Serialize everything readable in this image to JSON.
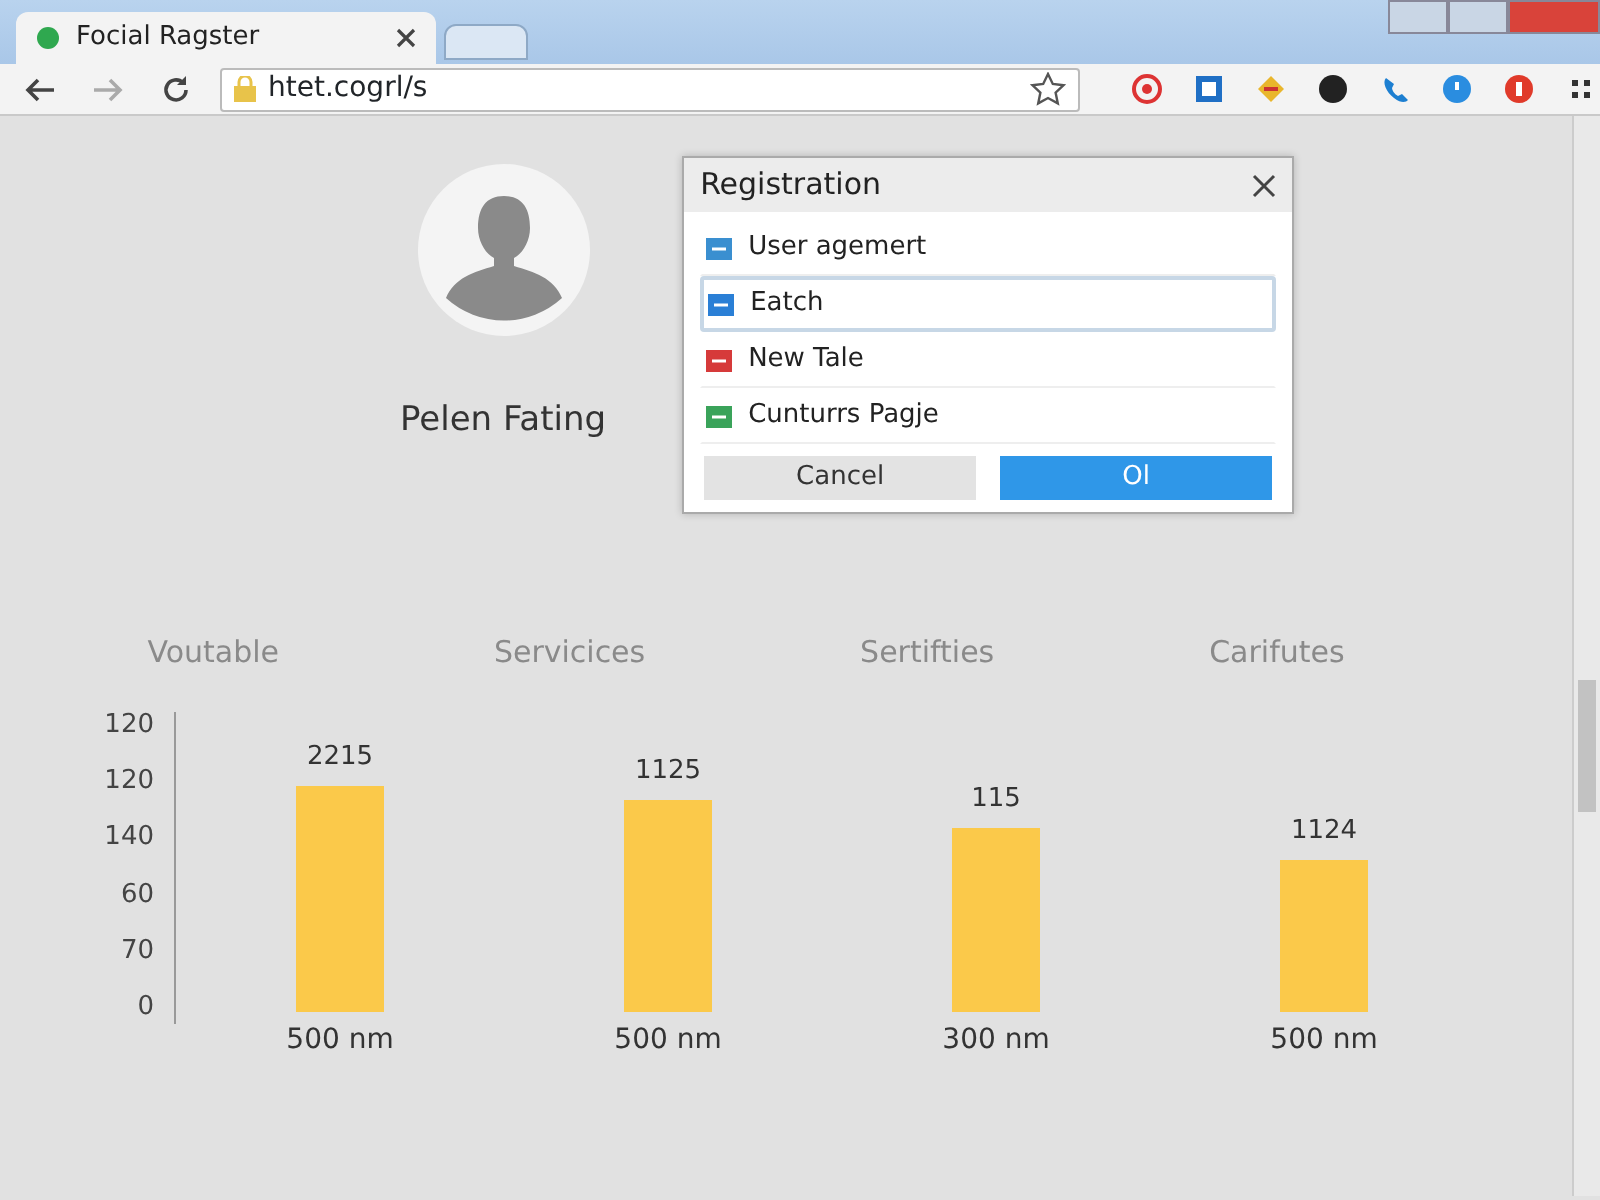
{
  "browser": {
    "tabs": [
      {
        "title": "Focial Ragster",
        "selected": true
      },
      {
        "selected": false
      }
    ],
    "address": "htet.cogrl/s"
  },
  "profile": {
    "name": "Pelen Fating"
  },
  "dialog": {
    "title": "Registration",
    "items": [
      {
        "label": "User agemert",
        "color": "#3a8fd0",
        "selected": false
      },
      {
        "label": "Eatch",
        "color": "#2a7fd6",
        "selected": true
      },
      {
        "label": "New Tale",
        "color": "#d63a3a",
        "selected": false
      },
      {
        "label": "Cunturrs Pagje",
        "color": "#3aa35a",
        "selected": false
      }
    ],
    "buttons": [
      {
        "label": "Cancel",
        "kind": "secondary"
      },
      {
        "label": "Ol",
        "kind": "primary"
      }
    ]
  },
  "column_labels": [
    "Voutable",
    "Servicices",
    "Sertifties",
    "Carifutes"
  ],
  "chart": {
    "y_labels": [
      "120",
      "120",
      "140",
      "60",
      "70",
      "0"
    ],
    "bars": [
      {
        "value_label": "2215",
        "category": "500 nm"
      },
      {
        "value_label": "1125",
        "category": "500 nm"
      },
      {
        "value_label": "115",
        "category": "300 nm"
      },
      {
        "value_label": "1124",
        "category": "500 nm"
      }
    ]
  }
}
